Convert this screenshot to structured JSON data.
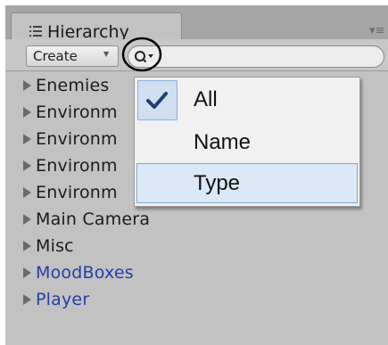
{
  "window": {
    "tab_title": "Hierarchy"
  },
  "toolbar": {
    "create_label": "Create"
  },
  "hierarchy": {
    "items": [
      {
        "label": "Enemies",
        "prefab": false
      },
      {
        "label": "Environm",
        "prefab": false
      },
      {
        "label": "Environm",
        "prefab": false
      },
      {
        "label": "Environm",
        "prefab": false
      },
      {
        "label": "Environm",
        "prefab": false
      },
      {
        "label": "Main Camera",
        "prefab": false
      },
      {
        "label": "Misc",
        "prefab": false
      },
      {
        "label": "MoodBoxes",
        "prefab": true
      },
      {
        "label": "Player",
        "prefab": true
      }
    ]
  },
  "search_menu": {
    "options": [
      {
        "label": "All",
        "checked": true
      },
      {
        "label": "Name",
        "checked": false
      },
      {
        "label": "Type",
        "checked": false,
        "highlighted": true
      }
    ]
  },
  "colors": {
    "prefab_text": "#243ea8",
    "menu_highlight": "#dbe8f5",
    "check_color": "#1f3f7a"
  }
}
